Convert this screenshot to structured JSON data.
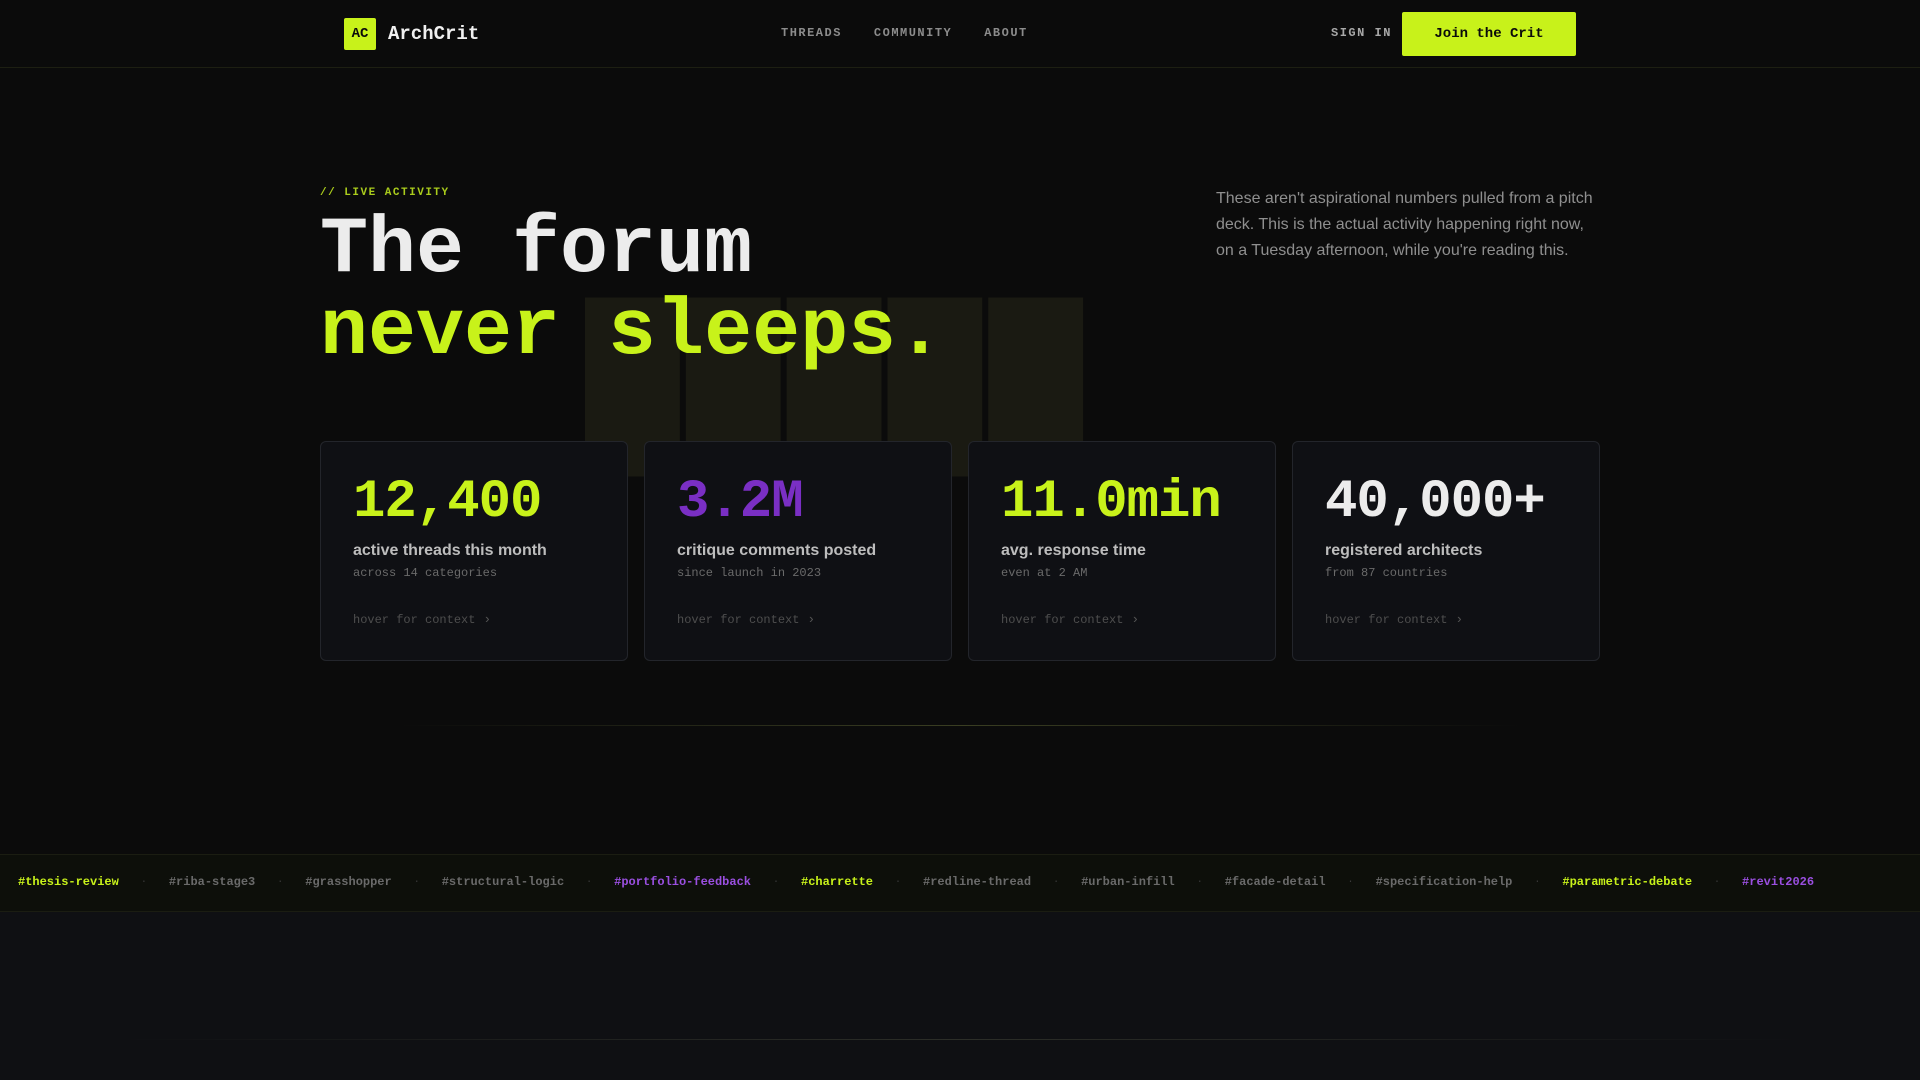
{
  "brand": {
    "mark": "AC",
    "name": "ArchCrit",
    "accent": "#c8f21a",
    "purple": "#7a2fc4"
  },
  "nav": {
    "links": [
      "THREADS",
      "COMMUNITY",
      "ABOUT"
    ],
    "sign_in": "SIGN IN",
    "cta": "Join the Crit"
  },
  "hero": {
    "eyebrow": "// LIVE ACTIVITY",
    "headline_line1": "The forum",
    "headline_line2": "never sleeps.",
    "description": "These aren't aspirational numbers pulled from a pitch deck. This is the actual activity happening right now, on a Tuesday afternoon, while you're reading this."
  },
  "stats": [
    {
      "value": "12,400",
      "label": "active threads this month",
      "sub": "across 14 categories",
      "hint": "hover for context",
      "color": "#c8f21a"
    },
    {
      "value": "3.2M",
      "label": "critique comments posted",
      "sub": "since launch in 2023",
      "hint": "hover for context",
      "color": "#7a2fc4"
    },
    {
      "value": "11.0min",
      "label": "avg. response time",
      "sub": "even at 2 AM",
      "hint": "hover for context",
      "color": "#c8f21a"
    },
    {
      "value": "40,000+",
      "label": "registered architects",
      "sub": "from 87 countries",
      "hint": "hover for context",
      "color": "#ececec"
    }
  ],
  "tags": [
    {
      "text": "#thesis-review",
      "style": "hl-green"
    },
    {
      "text": "#riba-stage3",
      "style": ""
    },
    {
      "text": "#grasshopper",
      "style": ""
    },
    {
      "text": "#structural-logic",
      "style": ""
    },
    {
      "text": "#portfolio-feedback",
      "style": "hl-purple"
    },
    {
      "text": "#charrette",
      "style": "hl-green"
    },
    {
      "text": "#redline-thread",
      "style": ""
    },
    {
      "text": "#urban-infill",
      "style": ""
    },
    {
      "text": "#facade-detail",
      "style": ""
    },
    {
      "text": "#specification-help",
      "style": ""
    },
    {
      "text": "#parametric-debate",
      "style": "hl-green"
    },
    {
      "text": "#revit2026",
      "style": "hl-purple"
    }
  ],
  "icons": {
    "logo": "ac-logo-icon",
    "chevron": "chevron-right-icon"
  }
}
